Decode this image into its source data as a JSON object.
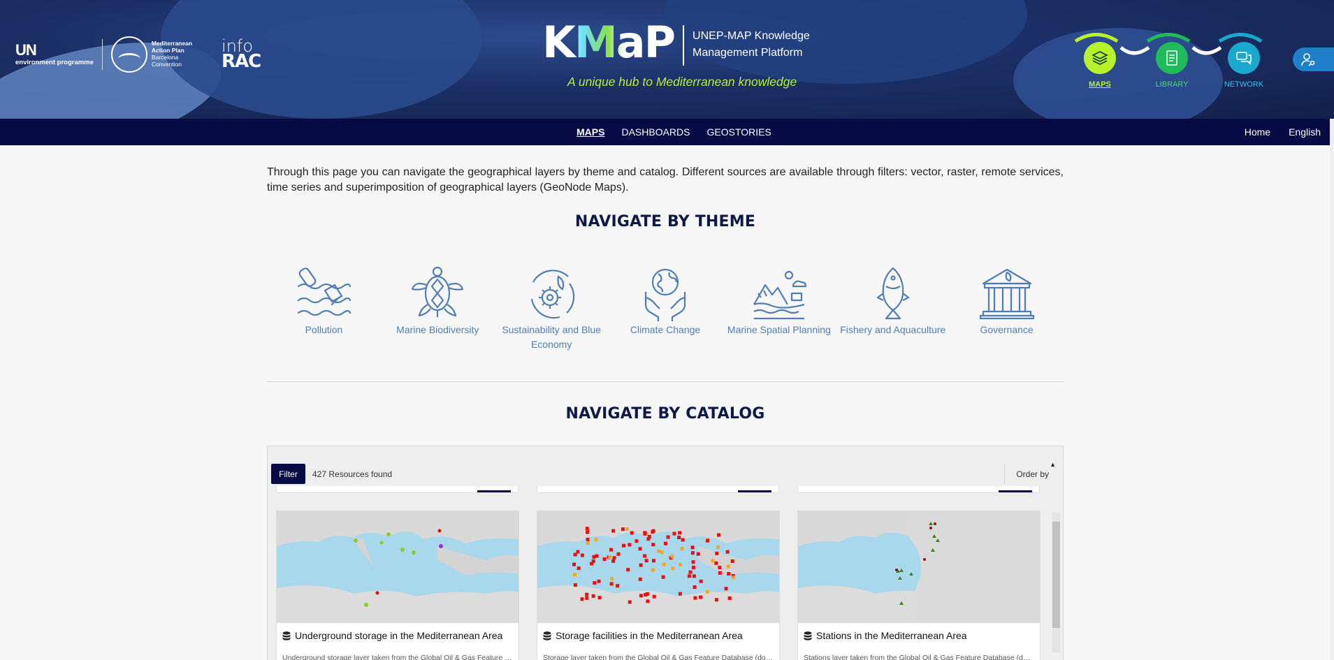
{
  "header": {
    "partners": {
      "un_top": "UN",
      "un_bottom": "environment programme",
      "map_line1": "Mediterranean",
      "map_line2": "Action Plan",
      "map_line3": "Barcelona",
      "map_line4": "Convention",
      "inforac_top": "info",
      "inforac_bottom": "RAC"
    },
    "brand": "KMaP",
    "brand_sub_line1": "UNEP-MAP Knowledge",
    "brand_sub_line2": "Management Platform",
    "tagline": "A unique hub to Mediterranean knowledge",
    "portal_links": [
      {
        "label": "MAPS",
        "icon": "layers-icon",
        "color": "#b8f22c"
      },
      {
        "label": "LIBRARY",
        "icon": "document-icon",
        "color": "#1fba5a"
      },
      {
        "label": "NETWORK",
        "icon": "chat-icon",
        "color": "#1aa8cf"
      }
    ]
  },
  "navbar": {
    "items": [
      "MAPS",
      "DASHBOARDS",
      "GEOSTORIES"
    ],
    "active": "MAPS",
    "home": "Home",
    "language": "English"
  },
  "intro": "Through this page you can navigate the geographical layers by theme and catalog. Different sources are available through filters: vector, raster, remote services, time series and superimposition of geographical layers (GeoNode Maps).",
  "theme_section": {
    "title": "NAVIGATE BY THEME",
    "themes": [
      {
        "label": "Pollution",
        "icon": "pollution-icon"
      },
      {
        "label": "Marine Biodiversity",
        "icon": "turtle-icon"
      },
      {
        "label": "Sustainability and Blue Economy",
        "icon": "recycle-gear-icon"
      },
      {
        "label": "Climate Change",
        "icon": "globe-hands-icon"
      },
      {
        "label": "Marine Spatial Planning",
        "icon": "landscape-icon"
      },
      {
        "label": "Fishery and Aquaculture",
        "icon": "fish-icon"
      },
      {
        "label": "Governance",
        "icon": "institution-icon"
      }
    ]
  },
  "catalog_section": {
    "title": "NAVIGATE BY CATALOG",
    "filter_label": "Filter",
    "resources_found": "427 Resources found",
    "order_by": "Order by",
    "cards": [
      {
        "title": "Underground storage in the Mediterranean Area",
        "description": "Underground storage layer taken from the Global Oil & Gas Feature D...",
        "icon": "database-icon"
      },
      {
        "title": "Storage facilities in the Mediterranean Area",
        "description": "Storage layer taken from the Global Oil & Gas Feature Database (dot: ...",
        "icon": "database-icon"
      },
      {
        "title": "Stations in the Mediterranean Area",
        "description": "Stations layer taken from the Global Oil & Gas Feature Database (dot: ...",
        "icon": "database-icon"
      }
    ]
  },
  "colors": {
    "navbar_bg": "#060b45",
    "header_bg": "#1b2f66",
    "theme_icon": "#4f7eb5",
    "maps_accent": "#b8f22c"
  }
}
